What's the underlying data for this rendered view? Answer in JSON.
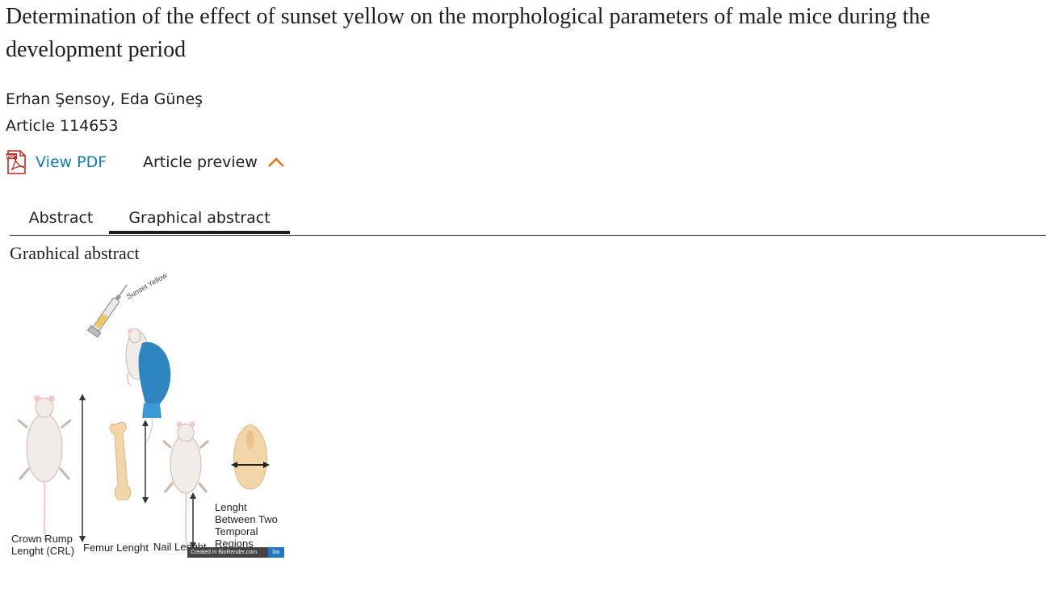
{
  "article": {
    "title": "Determination of the effect of sunset yellow on the morphological parameters of male mice during the development period",
    "authors": "Erhan Şensoy, Eda Güneş",
    "article_number": "Article 114653"
  },
  "links": {
    "view_pdf": "View PDF",
    "article_preview": "Article preview"
  },
  "tabs": [
    {
      "label": "Abstract",
      "active": false
    },
    {
      "label": "Graphical abstract",
      "active": true
    }
  ],
  "section_heading": "Graphical abstract",
  "figure": {
    "syringe_label": "Sunset Yellow",
    "labels": {
      "crl": "Crown Rump\nLenght (CRL)",
      "femur": "Femur Lenght",
      "nail": "Nail Lenght",
      "temporal": "Lenght\nBetween Two\nTemporal\nRegions"
    },
    "badge_text": "Created in BioRender.com",
    "badge_logo": "bio"
  },
  "colors": {
    "link": "#0c7dbb",
    "accent_chevron": "#e9711c",
    "glove": "#2e86c1"
  },
  "icons": {
    "pdf": "pdf-icon",
    "preview_toggle": "chevron-up-icon"
  }
}
